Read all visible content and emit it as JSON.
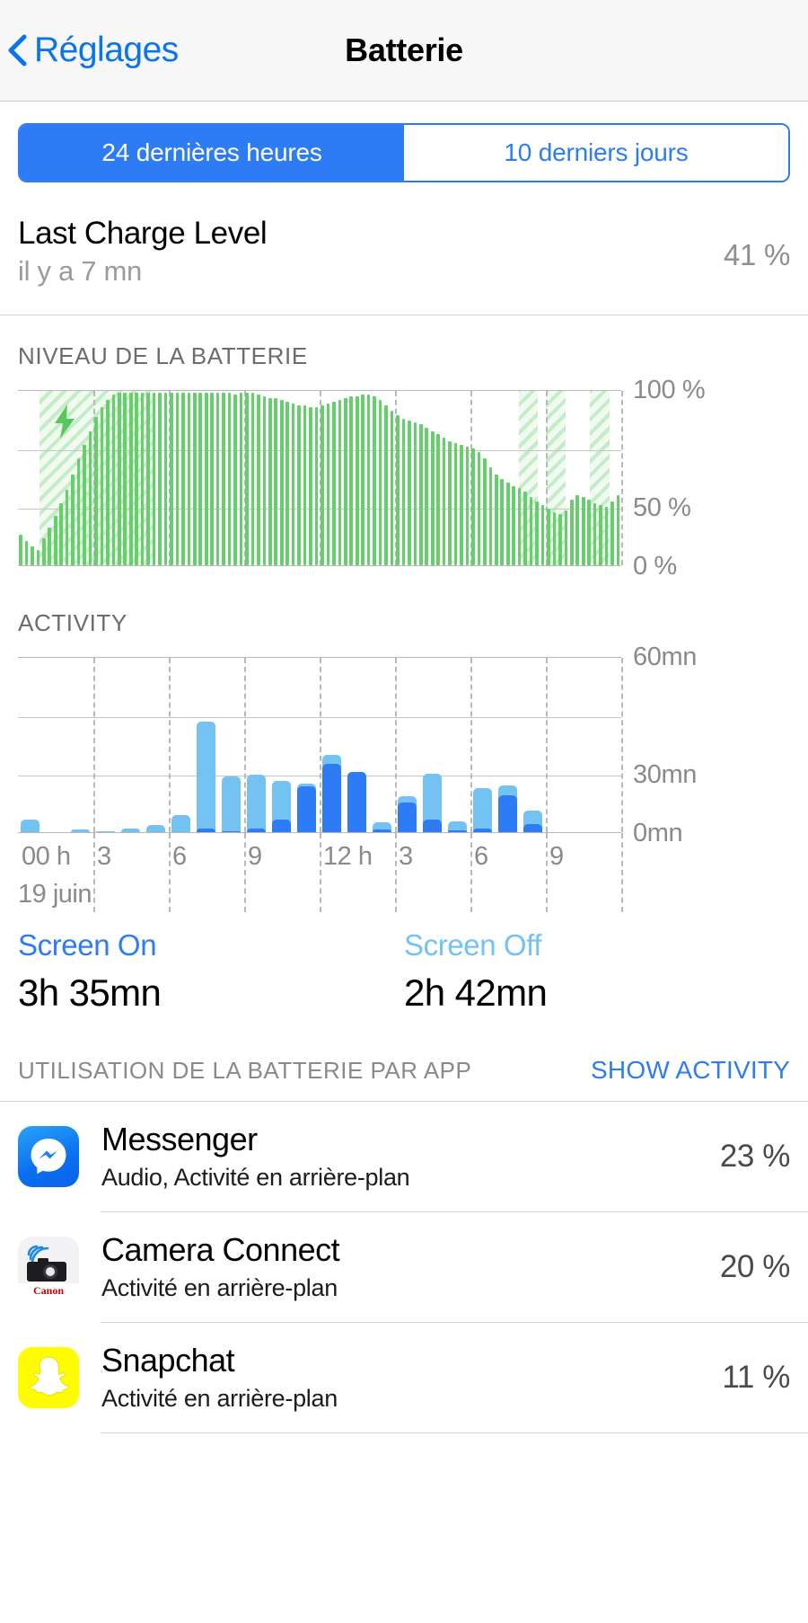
{
  "nav": {
    "back_label": "Réglages",
    "back_icon": "chevron-left-icon",
    "title": "Batterie"
  },
  "segmented": {
    "options": [
      {
        "label": "24 dernières heures",
        "selected": true
      },
      {
        "label": "10 derniers jours",
        "selected": false
      }
    ]
  },
  "last_charge": {
    "title": "Last Charge Level",
    "subtitle": "il y a 7 mn",
    "percent": "41 %"
  },
  "battery_section": {
    "label": "NIVEAU DE LA BATTERIE",
    "y_labels": [
      "100 %",
      "50 %",
      "0 %"
    ],
    "charging_icon": "lightning-bolt-icon"
  },
  "activity_section": {
    "label": "ACTIVITY",
    "y_labels": [
      "60mn",
      "30mn",
      "0mn"
    ],
    "x_labels": [
      "00 h",
      "3",
      "6",
      "9",
      "12 h",
      "3",
      "6",
      "9"
    ],
    "date_label": "19 juin"
  },
  "screen_stats": [
    {
      "label": "Screen On",
      "value": "3h 35mn",
      "color": "#2d7cf6"
    },
    {
      "label": "Screen Off",
      "value": "2h 42mn",
      "color": "#73c2f2"
    }
  ],
  "usage": {
    "title": "UTILISATION DE LA BATTERIE PAR APP",
    "action": "SHOW ACTIVITY",
    "apps": [
      {
        "name": "Messenger",
        "desc": "Audio, Activité en arrière-plan",
        "percent": "23 %",
        "icon": "messenger-icon"
      },
      {
        "name": "Camera Connect",
        "desc": "Activité en arrière-plan",
        "percent": "20 %",
        "icon": "canon-camera-connect-icon",
        "brand_text": "Canon"
      },
      {
        "name": "Snapchat",
        "desc": "Activité en arrière-plan",
        "percent": "11 %",
        "icon": "snapchat-ghost-icon"
      }
    ]
  },
  "colors": {
    "accent_blue": "#2d7cf6",
    "light_blue": "#73c2f2",
    "battery_green": "#67ce6c",
    "gray_text": "#8a8a8e"
  },
  "chart_data": [
    {
      "type": "bar",
      "id": "battery-level",
      "title": "NIVEAU DE LA BATTERIE",
      "xlabel": "",
      "ylabel": "",
      "ylim": [
        0,
        100
      ],
      "yticks": [
        0,
        50,
        100
      ],
      "ytick_labels": [
        "0 %",
        "50 %",
        "100 %"
      ],
      "grid": true,
      "bar_color": "#67ce6c",
      "values": [
        18,
        14,
        11,
        9,
        16,
        22,
        29,
        36,
        44,
        53,
        62,
        70,
        78,
        86,
        92,
        96,
        99,
        100,
        100,
        100,
        100,
        100,
        100,
        100,
        100,
        100,
        100,
        100,
        100,
        100,
        100,
        100,
        100,
        100,
        100,
        100,
        100,
        99,
        100,
        100,
        100,
        99,
        98,
        97,
        97,
        96,
        95,
        94,
        93,
        93,
        92,
        92,
        93,
        94,
        95,
        96,
        97,
        98,
        98,
        99,
        99,
        98,
        96,
        93,
        90,
        87,
        85,
        84,
        83,
        82,
        80,
        78,
        76,
        74,
        72,
        71,
        70,
        69,
        68,
        66,
        62,
        57,
        53,
        50,
        48,
        46,
        45,
        43,
        40,
        37,
        35,
        33,
        31,
        30,
        32,
        38,
        41,
        40,
        38,
        36,
        35,
        34,
        37,
        41
      ],
      "charging_bands": [
        {
          "start_pct": 3.5,
          "width_pct": 19.0
        },
        {
          "start_pct": 83.0,
          "width_pct": 3.2
        },
        {
          "start_pct": 87.5,
          "width_pct": 3.2
        },
        {
          "start_pct": 94.8,
          "width_pct": 3.2
        }
      ]
    },
    {
      "type": "bar",
      "id": "activity",
      "stacked": true,
      "title": "ACTIVITY",
      "xlabel": "",
      "ylabel": "",
      "ylim": [
        0,
        60
      ],
      "yticks": [
        0,
        30,
        60
      ],
      "ytick_labels": [
        "0mn",
        "30mn",
        "60mn"
      ],
      "grid": true,
      "categories": [
        "00 h",
        "3",
        "6",
        "9",
        "12 h",
        "3",
        "6",
        "9"
      ],
      "series": [
        {
          "name": "Screen On",
          "color": "#2d7cf6",
          "values": [
            0,
            0,
            0,
            0,
            0,
            0,
            0,
            1.5,
            0.5,
            1.5,
            4.5,
            16,
            24,
            21,
            1,
            10.5,
            4.5,
            0.8,
            1.5,
            13,
            3
          ]
        },
        {
          "name": "Screen Off",
          "color": "#73c2f2",
          "values": [
            4.5,
            0,
            1,
            0.4,
            1.2,
            2.5,
            6,
            37,
            19,
            18.5,
            13.5,
            1,
            3,
            0,
            2.5,
            2,
            16,
            3,
            14,
            3.5,
            4.5
          ]
        }
      ]
    }
  ]
}
